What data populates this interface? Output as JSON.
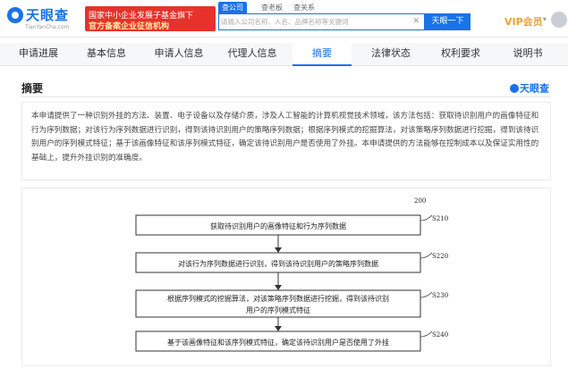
{
  "header": {
    "logo_text": "天眼查",
    "logo_url": "TianYanCha.com",
    "banner_line1": "国家中小企业发展子基金旗下",
    "banner_line2": "官方备案企业征信机构",
    "search_tabs": [
      "查公司",
      "查老板",
      "查关系"
    ],
    "search_placeholder": "请输入公司名称、人名、品牌名称等关键词",
    "search_button": "天眼一下",
    "vip_label": "VIP会员"
  },
  "tabs": [
    "申请进展",
    "基本信息",
    "申请人信息",
    "代理人信息",
    "摘要",
    "法律状态",
    "权利要求",
    "说明书"
  ],
  "active_tab": "摘要",
  "section": {
    "title": "摘要",
    "logo_text": "天眼查"
  },
  "abstract": {
    "text": "本申请提供了一种识别外挂的方法、装置、电子设备以及存储介质，涉及人工智能的计算机视觉技术领域，该方法包括：获取待识别用户的画像特征和行为序列数据；对该行为序列数据进行识别，得到该待识别用户的策略序列数据；根据序列模式的挖掘算法，对该策略序列数据进行挖掘，得到该待识别用户的序列模式特征；基于该画像特征和该序列模式特征，确定该待识别用户是否使用了外挂。本申请提供的方法能够在控制成本以及保证实用性的基础上，提升外挂识别的准确度。"
  },
  "figure": {
    "number": "200",
    "steps": [
      {
        "label": "S210",
        "lines": [
          "获取待识别用户的画像特征和行为序列数据"
        ]
      },
      {
        "label": "S220",
        "lines": [
          "对该行为序列数据进行识别，得到该待识别用户的策略序列数据"
        ]
      },
      {
        "label": "S230",
        "lines": [
          "根据序列模式的挖掘算法，对该策略序列数据进行挖掘，得到该待识别",
          "用户的序列模式特征"
        ]
      },
      {
        "label": "S240",
        "lines": [
          "基于该画像特征和该序列模式特征，确定该待识别用户是否使用了外挂"
        ]
      }
    ]
  },
  "colors": {
    "brand": "#1a72e8",
    "banner": "#e7322a",
    "vip": "#e6a23c"
  }
}
